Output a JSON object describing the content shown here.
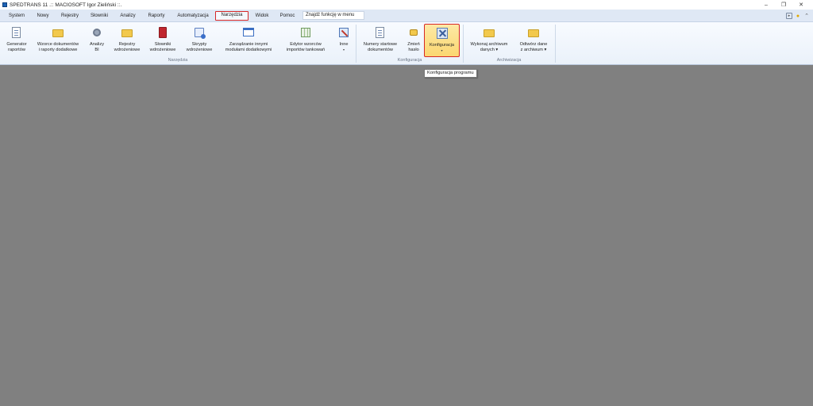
{
  "window": {
    "title": "SPEDTRANS 11 .:: MACIOSOFT Igor Zieliński ::.",
    "controls": {
      "minimize": "–",
      "restore": "❐",
      "close": "✕"
    }
  },
  "menu": {
    "items": [
      "System",
      "Nowy",
      "Rejestry",
      "Słowniki",
      "Analizy",
      "Raporty",
      "Automatyzacja",
      "Narzędzia",
      "Widok",
      "Pomoc"
    ],
    "active": "Narzędzia",
    "search_placeholder": "Znajdź funkcję w menu",
    "right_icons": [
      "help-box-icon",
      "lightbulb-icon",
      "ribbon-collapse-icon"
    ]
  },
  "ribbon": {
    "groups": [
      {
        "label": "Narzędzia",
        "buttons": [
          {
            "icon": "report-generator-icon",
            "lines": [
              "Generator",
              "raportów"
            ]
          },
          {
            "icon": "document-templates-icon",
            "lines": [
              "Wzorce dokumentów",
              "i raporty dodatkowe"
            ]
          },
          {
            "icon": "analysis-bi-icon",
            "lines": [
              "Analizy",
              "BI"
            ]
          },
          {
            "icon": "implementation-registers-icon",
            "lines": [
              "Rejestry",
              "wdrożeniowe"
            ]
          },
          {
            "icon": "implementation-dictionaries-icon",
            "lines": [
              "Słowniki",
              "wdrożeniowe"
            ]
          },
          {
            "icon": "implementation-scripts-icon",
            "lines": [
              "Skrypty",
              "wdrożeniowe"
            ]
          },
          {
            "icon": "modules-manager-icon",
            "lines": [
              "Zarządzanie innymi",
              "modułami dodatkowymi"
            ]
          },
          {
            "icon": "fuel-import-editor-icon",
            "lines": [
              "Edytor wzorców",
              "importów tankowań"
            ]
          },
          {
            "icon": "other-tools-icon",
            "lines": [
              "Inne",
              "▾"
            ]
          }
        ]
      },
      {
        "label": "Konfiguracja",
        "buttons": [
          {
            "icon": "start-numbers-icon",
            "lines": [
              "Numery startowe",
              "dokumentów"
            ]
          },
          {
            "icon": "change-password-icon",
            "lines": [
              "Zmień",
              "hasło"
            ]
          },
          {
            "icon": "configuration-icon",
            "lines": [
              "Konfiguracja",
              "▾"
            ]
          }
        ]
      },
      {
        "label": "Archiwizacja",
        "buttons": [
          {
            "icon": "archive-data-icon",
            "lines": [
              "Wykonaj archiwum",
              "danych ▾"
            ]
          },
          {
            "icon": "restore-archive-icon",
            "lines": [
              "Odtwórz dane",
              "z archiwum ▾"
            ]
          }
        ]
      }
    ]
  },
  "tooltip": {
    "text": "Konfiguracja programu"
  }
}
